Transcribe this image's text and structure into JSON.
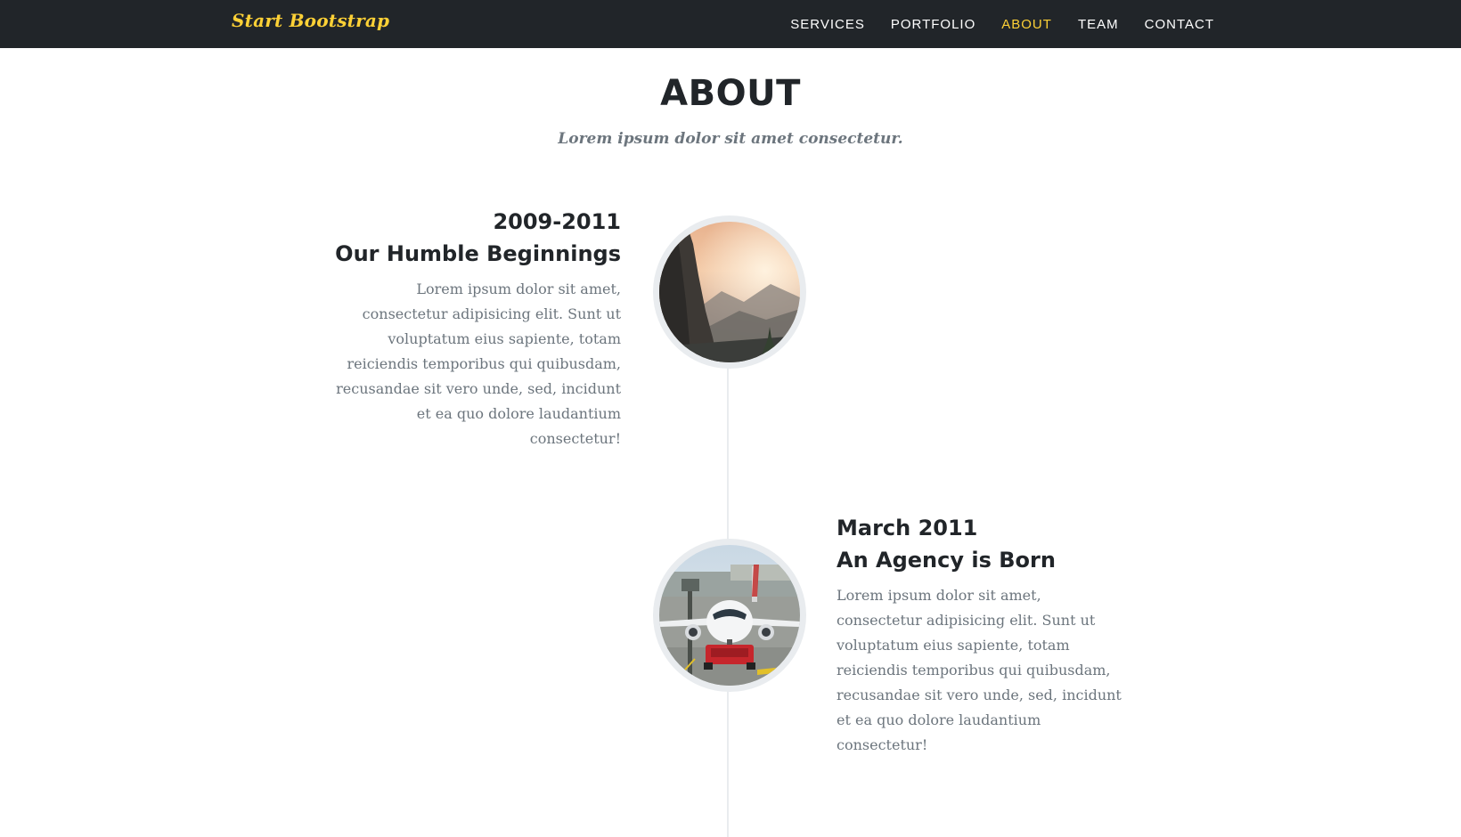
{
  "navbar": {
    "brand": "Start Bootstrap",
    "accent_color": "#fed136",
    "background_color": "#212529",
    "items": [
      {
        "label": "SERVICES"
      },
      {
        "label": "PORTFOLIO"
      },
      {
        "label": "ABOUT",
        "active": true
      },
      {
        "label": "TEAM"
      },
      {
        "label": "CONTACT"
      }
    ]
  },
  "about": {
    "heading": "ABOUT",
    "subheading": "Lorem ipsum dolor sit amet consectetur.",
    "timeline": [
      {
        "date": "2009-2011",
        "title": "Our Humble Beginnings",
        "body": "Lorem ipsum dolor sit amet, consectetur adipisicing elit. Sunt ut voluptatum eius sapiente, totam reiciendis temporibus qui quibusdam, recusandae sit vero unde, sed, incidunt et ea quo dolore laudantium consectetur!",
        "image": "mountain-valley-photo"
      },
      {
        "date": "March 2011",
        "title": "An Agency is Born",
        "body": "Lorem ipsum dolor sit amet, consectetur adipisicing elit. Sunt ut voluptatum eius sapiente, totam reiciendis temporibus qui quibusdam, recusandae sit vero unde, sed, incidunt et ea quo dolore laudantium consectetur!",
        "image": "airplane-at-airport-photo"
      }
    ]
  }
}
